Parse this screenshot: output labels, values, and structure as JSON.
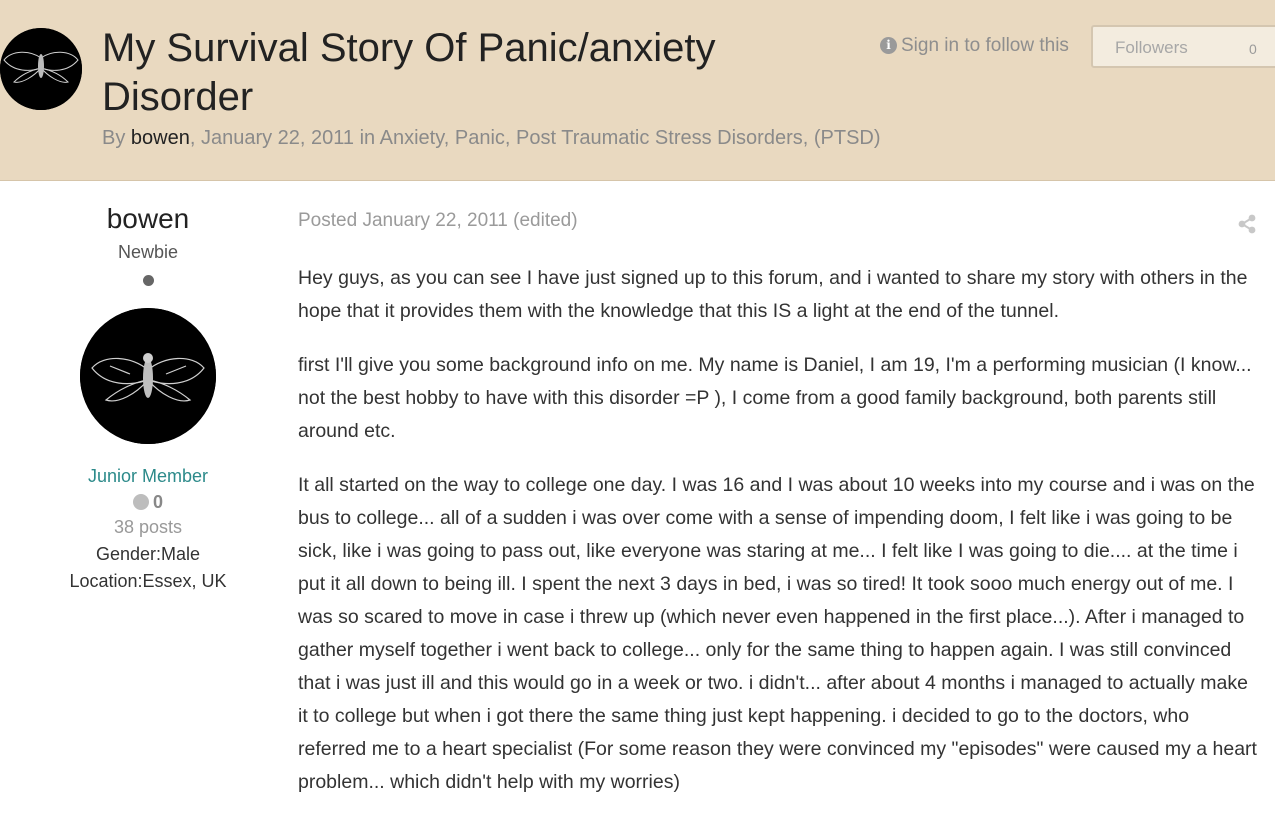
{
  "topic": {
    "title": "My Survival Story Of Panic/anxiety Disorder",
    "by_prefix": "By",
    "author": "bowen",
    "date": "January 22, 2011",
    "in_word": "in",
    "forum": "Anxiety, Panic, Post Traumatic Stress Disorders, (PTSD)"
  },
  "follow": {
    "sign_in_text": "Sign in to follow this",
    "followers_label": "Followers",
    "followers_count": "0"
  },
  "author_panel": {
    "name": "bowen",
    "rank_title": "Newbie",
    "group": "Junior Member",
    "reputation": "0",
    "posts": "38 posts",
    "gender": "Gender:Male",
    "location": "Location:Essex, UK"
  },
  "post": {
    "posted_label": "Posted",
    "date": "January 22, 2011",
    "edited": "(edited)",
    "paragraphs": [
      "Hey guys, as you can see I have just signed up to this forum, and i wanted to share my story with others in the hope that it provides them with the knowledge that this IS a light at the end of the tunnel.",
      "first I'll give you some background info on me. My name is Daniel, I am 19, I'm a performing musician (I know... not the best hobby to have with this disorder =P ), I come from a good family background, both parents still around etc.",
      "It all started on the way to college one day. I was 16 and I was about 10 weeks into my course and i was on the bus to college... all of a sudden i was over come with a sense of impending doom, I felt like i was going to be sick, like i was going to pass out, like everyone was staring at me... I felt like I was going to die.... at the time i put it all down to being ill. I spent the next 3 days in bed, i was so tired! It took sooo much energy out of me. I was so scared to move in case i threw up (which never even happened in the first place...). After i managed to gather myself together i went back to college... only for the same thing to happen again. I was still convinced that i was just ill and this would go in a week or two. i didn't... after about 4 months i managed to actually make it to college but when i got there the same thing just kept happening. i decided to go to the doctors, who referred me to a heart specialist (For some reason they were convinced my \"episodes\" were caused my a heart problem... which didn't help with my worries)"
    ]
  },
  "icons": {
    "info": "info-icon",
    "share": "share-icon",
    "status": "offline-status-icon",
    "reputation": "reputation-icon"
  }
}
